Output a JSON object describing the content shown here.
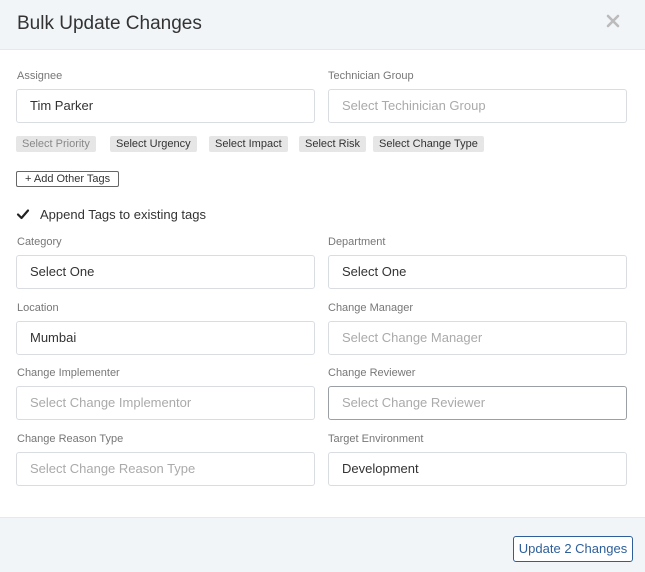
{
  "modal": {
    "title": "Bulk Update Changes",
    "close_icon": "close-icon"
  },
  "fields": {
    "assignee": {
      "label": "Assignee",
      "value": "Tim Parker"
    },
    "technician_group": {
      "label": "Technician Group",
      "placeholder": "Select Techinician Group"
    },
    "category": {
      "label": "Category",
      "value": "Select One"
    },
    "department": {
      "label": "Department",
      "value": "Select One"
    },
    "location": {
      "label": "Location",
      "value": "Mumbai"
    },
    "change_manager": {
      "label": "Change Manager",
      "placeholder": "Select Change Manager"
    },
    "change_implementer": {
      "label": "Change Implementer",
      "placeholder": "Select Change Implementor"
    },
    "change_reviewer": {
      "label": "Change Reviewer",
      "placeholder": "Select Change Reviewer"
    },
    "change_reason_type": {
      "label": "Change Reason Type",
      "placeholder": "Select Change Reason Type"
    },
    "target_environment": {
      "label": "Target Environment",
      "value": "Development"
    }
  },
  "tags": {
    "priority": "Select Priority",
    "urgency": "Select Urgency",
    "impact": "Select Impact",
    "risk": "Select Risk",
    "change_type": "Select Change Type",
    "add_other": "+ Add Other Tags"
  },
  "append_tags": {
    "label": "Append Tags to existing tags",
    "checked": true
  },
  "footer": {
    "update_label": "Update 2 Changes"
  },
  "colors": {
    "header_bg": "#f1f5f8",
    "primary": "#2e5f9a",
    "tag_bg": "#e6e6e6"
  }
}
